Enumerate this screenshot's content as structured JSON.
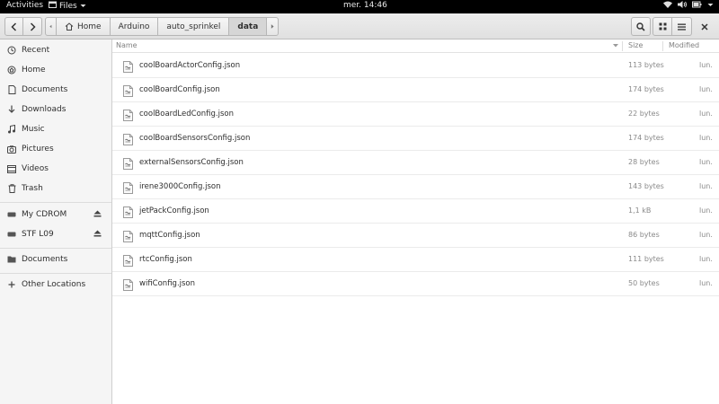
{
  "topbar": {
    "activities": "Activities",
    "app_menu": "Files",
    "clock": "mer. 14:46"
  },
  "header": {
    "path": [
      {
        "label": "Home",
        "icon": "home-icon"
      },
      {
        "label": "Arduino"
      },
      {
        "label": "auto_sprinkel"
      },
      {
        "label": "data",
        "active": true
      }
    ]
  },
  "sidebar": {
    "items": [
      {
        "label": "Recent",
        "icon": "recent-icon"
      },
      {
        "label": "Home",
        "icon": "home-icon"
      },
      {
        "label": "Documents",
        "icon": "document-icon"
      },
      {
        "label": "Downloads",
        "icon": "download-icon"
      },
      {
        "label": "Music",
        "icon": "music-icon"
      },
      {
        "label": "Pictures",
        "icon": "picture-icon"
      },
      {
        "label": "Videos",
        "icon": "video-icon"
      },
      {
        "label": "Trash",
        "icon": "trash-icon"
      }
    ],
    "devices": [
      {
        "label": "My CDROM",
        "icon": "drive-icon"
      },
      {
        "label": "STF L09",
        "icon": "drive-icon"
      }
    ],
    "bookmarks": [
      {
        "label": "Documents",
        "icon": "folder-icon"
      }
    ],
    "other": {
      "label": "Other Locations",
      "icon": "plus-icon"
    }
  },
  "columns": {
    "name": "Name",
    "size": "Size",
    "modified": "Modified"
  },
  "files": [
    {
      "name": "coolBoardActorConfig.json",
      "size": "113 bytes",
      "modified": "lun."
    },
    {
      "name": "coolBoardConfig.json",
      "size": "174 bytes",
      "modified": "lun."
    },
    {
      "name": "coolBoardLedConfig.json",
      "size": "22 bytes",
      "modified": "lun."
    },
    {
      "name": "coolBoardSensorsConfig.json",
      "size": "174 bytes",
      "modified": "lun."
    },
    {
      "name": "externalSensorsConfig.json",
      "size": "28 bytes",
      "modified": "lun."
    },
    {
      "name": "irene3000Config.json",
      "size": "143 bytes",
      "modified": "lun."
    },
    {
      "name": "jetPackConfig.json",
      "size": "1,1 kB",
      "modified": "lun."
    },
    {
      "name": "mqttConfig.json",
      "size": "86 bytes",
      "modified": "lun."
    },
    {
      "name": "rtcConfig.json",
      "size": "111 bytes",
      "modified": "lun."
    },
    {
      "name": "wifiConfig.json",
      "size": "50 bytes",
      "modified": "lun."
    }
  ]
}
